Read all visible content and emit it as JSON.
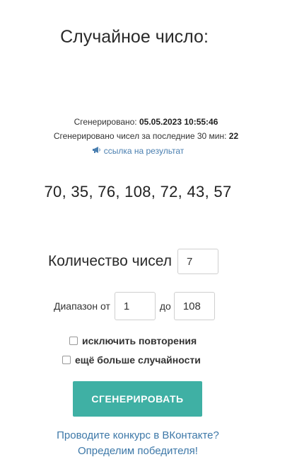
{
  "title": "Случайное число:",
  "meta": {
    "generated_label": "Сгенерировано:",
    "generated_value": "05.05.2023 10:55:46",
    "count_label": "Сгенерировано чисел за последние 30 мин:",
    "count_value": "22"
  },
  "link": {
    "icon": "megaphone-icon",
    "text": "ссылка на результат"
  },
  "result": "70, 35, 76, 108, 72, 43, 57",
  "form": {
    "count_label": "Количество чисел",
    "count_value": "7",
    "range_label": "Диапазон от",
    "range_from": "1",
    "range_to_label": "до",
    "range_to": "108",
    "exclude_repeats_label": "исключить повторения",
    "more_random_label": "ещё больше случайности",
    "generate_button": "СГЕНЕРИРОВАТЬ"
  },
  "promo": {
    "line1": "Проводите конкурс в ВКонтакте?",
    "line2": "Определим победителя!"
  },
  "colors": {
    "button": "#3fb0a4",
    "link": "#4a7fb0"
  }
}
